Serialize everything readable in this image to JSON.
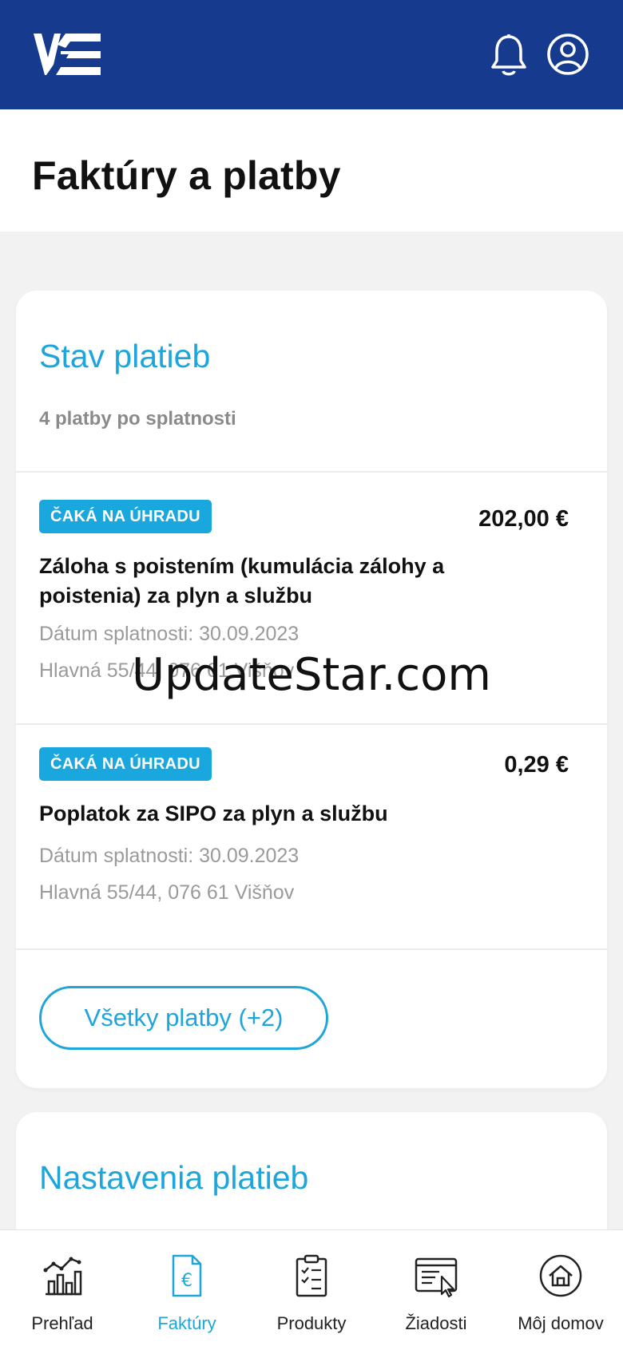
{
  "header": {
    "logo_icon": "vse-logo",
    "bell_icon": "bell-icon",
    "profile_icon": "user-circle-icon"
  },
  "page": {
    "title": "Faktúry a platby"
  },
  "payments_status": {
    "title": "Stav platieb",
    "subtitle": "4 platby po splatnosti",
    "items": [
      {
        "badge": "ČAKÁ NA ÚHRADU",
        "amount": "202,00 €",
        "name": "Záloha s poistením (kumulácia zálohy a poistenia) za plyn a službu",
        "due": "Dátum splatnosti: 30.09.2023",
        "address": "Hlavná 55/44, 076 61 Višňov"
      },
      {
        "badge": "ČAKÁ NA ÚHRADU",
        "amount": "0,29 €",
        "name": "Poplatok za SIPO za plyn a službu",
        "due": "Dátum splatnosti: 30.09.2023",
        "address": "Hlavná 55/44, 076 61 Višňov"
      }
    ],
    "all_button": "Všetky platby (+2)"
  },
  "payment_settings": {
    "title": "Nastavenia platieb"
  },
  "watermark": "UpdateStar.com",
  "bottom_nav": [
    {
      "label": "Prehľad",
      "icon": "chart-icon"
    },
    {
      "label": "Faktúry",
      "icon": "invoice-euro-icon",
      "active": true
    },
    {
      "label": "Produkty",
      "icon": "clipboard-checklist-icon"
    },
    {
      "label": "Žiadosti",
      "icon": "requests-window-icon"
    },
    {
      "label": "Môj domov",
      "icon": "home-icon"
    }
  ],
  "colors": {
    "header_bg": "#153a8e",
    "accent": "#1ea6dc",
    "badge_bg": "#1aa7dd",
    "page_bg": "#f2f2f2"
  }
}
